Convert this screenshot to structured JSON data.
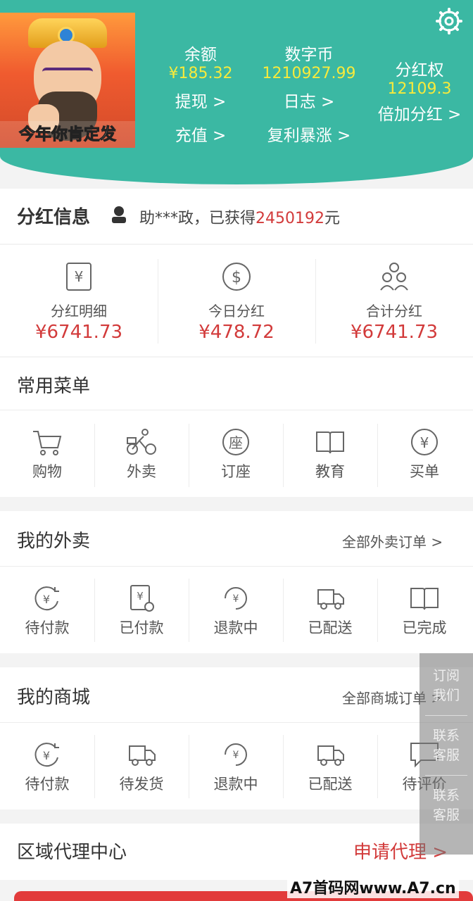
{
  "header": {
    "avatar_caption": "今年你肯定发",
    "balance_label": "余额",
    "balance_value": "¥185.32",
    "withdraw": "提现 >",
    "recharge": "充值 >",
    "coin_label": "数字币",
    "coin_value": "1210927.99",
    "log": "日志 >",
    "compound": "复利暴涨 >",
    "dividend_right_label": "分红权",
    "dividend_right_value": "12109.3",
    "double_dividend": "倍加分红 >"
  },
  "dividend_info": {
    "title": "分红信息",
    "ticker_prefix": "助***政，已获得",
    "ticker_amount": "2450192",
    "ticker_suffix": "元"
  },
  "stats": [
    {
      "label": "分红明细",
      "value": "¥6741.73",
      "icon": "yen-receipt-icon"
    },
    {
      "label": "今日分红",
      "value": "¥478.72",
      "icon": "dollar-coin-icon"
    },
    {
      "label": "合计分红",
      "value": "¥6741.73",
      "icon": "people-group-icon"
    }
  ],
  "common_menu": {
    "title": "常用菜单",
    "items": [
      {
        "label": "购物",
        "icon": "cart-icon"
      },
      {
        "label": "外卖",
        "icon": "delivery-bike-icon"
      },
      {
        "label": "订座",
        "icon": "seat-icon"
      },
      {
        "label": "教育",
        "icon": "book-icon"
      },
      {
        "label": "买单",
        "icon": "yen-circle-icon"
      }
    ]
  },
  "takeout": {
    "title": "我的外卖",
    "all_orders": "全部外卖订单 >",
    "items": [
      {
        "label": "待付款",
        "icon": "yen-refresh-icon"
      },
      {
        "label": "已付款",
        "icon": "yen-clock-doc-icon"
      },
      {
        "label": "退款中",
        "icon": "refund-icon"
      },
      {
        "label": "已配送",
        "icon": "truck-icon"
      },
      {
        "label": "已完成",
        "icon": "book-icon"
      }
    ]
  },
  "mall": {
    "title": "我的商城",
    "all_orders": "全部商城订单 >",
    "items": [
      {
        "label": "待付款",
        "icon": "yen-refresh-icon"
      },
      {
        "label": "待发货",
        "icon": "truck-icon"
      },
      {
        "label": "退款中",
        "icon": "refund-icon"
      },
      {
        "label": "已配送",
        "icon": "truck-icon"
      },
      {
        "label": "待评价",
        "icon": "comment-icon"
      }
    ]
  },
  "agent": {
    "title": "区域代理中心",
    "apply": "申请代理 >"
  },
  "float": {
    "subscribe": "订阅\n我们",
    "contact1": "联系\n客服",
    "contact2": "联系\n客服"
  },
  "watermark": "A7首码网www.A7.cn"
}
